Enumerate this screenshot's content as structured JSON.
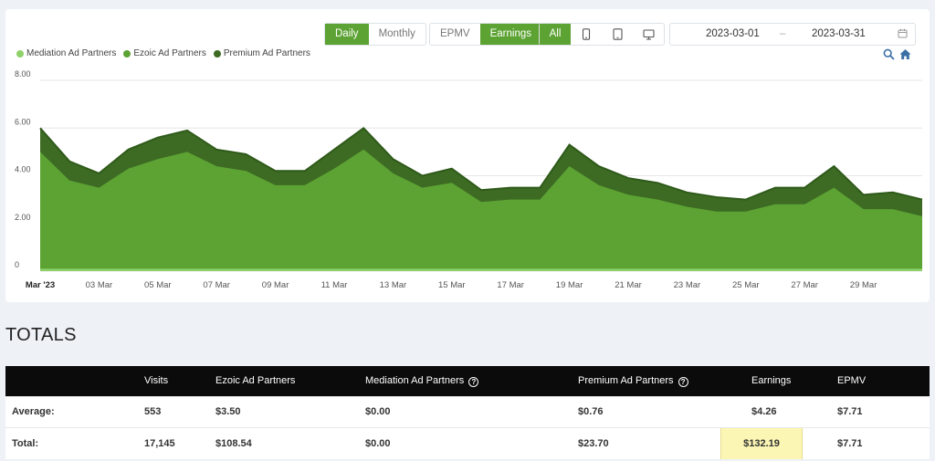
{
  "toolbar": {
    "period": [
      {
        "label": "Daily",
        "active": true
      },
      {
        "label": "Monthly",
        "active": false
      }
    ],
    "metric": [
      {
        "label": "EPMV",
        "active": false
      },
      {
        "label": "Earnings",
        "active": true
      }
    ],
    "device_all_label": "All",
    "device_icons": [
      "phone-icon",
      "tablet-icon",
      "desktop-icon"
    ],
    "date_start": "2023-03-01",
    "date_separator": "–",
    "date_end": "2023-03-31"
  },
  "legend": [
    {
      "name": "Mediation Ad Partners",
      "color": "#8fd16a"
    },
    {
      "name": "Ezoic Ad Partners",
      "color": "#5da334"
    },
    {
      "name": "Premium Ad Partners",
      "color": "#3d6b23"
    }
  ],
  "chart_data": {
    "type": "area",
    "stacked": true,
    "x": [
      "2023-03-01",
      "2023-03-02",
      "2023-03-03",
      "2023-03-04",
      "2023-03-05",
      "2023-03-06",
      "2023-03-07",
      "2023-03-08",
      "2023-03-09",
      "2023-03-10",
      "2023-03-11",
      "2023-03-12",
      "2023-03-13",
      "2023-03-14",
      "2023-03-15",
      "2023-03-16",
      "2023-03-17",
      "2023-03-18",
      "2023-03-19",
      "2023-03-20",
      "2023-03-21",
      "2023-03-22",
      "2023-03-23",
      "2023-03-24",
      "2023-03-25",
      "2023-03-26",
      "2023-03-27",
      "2023-03-28",
      "2023-03-29",
      "2023-03-30",
      "2023-03-31"
    ],
    "x_tick_labels": [
      "Mar '23",
      "03 Mar",
      "05 Mar",
      "07 Mar",
      "09 Mar",
      "11 Mar",
      "13 Mar",
      "15 Mar",
      "17 Mar",
      "19 Mar",
      "21 Mar",
      "23 Mar",
      "25 Mar",
      "27 Mar",
      "29 Mar"
    ],
    "x_tick_indices": [
      0,
      2,
      4,
      6,
      8,
      10,
      12,
      14,
      16,
      18,
      20,
      22,
      24,
      26,
      28
    ],
    "y_tick_labels": [
      "0",
      "2.00",
      "4.00",
      "6.00",
      "8.00"
    ],
    "y_ticks": [
      0,
      2,
      4,
      6,
      8
    ],
    "ylim": [
      0,
      8
    ],
    "series": [
      {
        "name": "Mediation Ad Partners",
        "color": "#8fd16a",
        "values": [
          0.1,
          0.1,
          0.1,
          0.1,
          0.1,
          0.1,
          0.1,
          0.1,
          0.1,
          0.1,
          0.1,
          0.1,
          0.1,
          0.1,
          0.1,
          0.1,
          0.1,
          0.1,
          0.1,
          0.1,
          0.1,
          0.1,
          0.1,
          0.1,
          0.1,
          0.1,
          0.1,
          0.1,
          0.1,
          0.1,
          0.1
        ]
      },
      {
        "name": "Ezoic Ad Partners",
        "color": "#5da334",
        "values": [
          4.9,
          3.7,
          3.4,
          4.2,
          4.6,
          4.9,
          4.3,
          4.1,
          3.5,
          3.5,
          4.2,
          5.0,
          4.0,
          3.4,
          3.6,
          2.8,
          2.9,
          2.9,
          4.3,
          3.5,
          3.1,
          2.9,
          2.6,
          2.4,
          2.4,
          2.7,
          2.7,
          3.4,
          2.5,
          2.5,
          2.2
        ]
      },
      {
        "name": "Premium Ad Partners",
        "color": "#3d6b23",
        "values": [
          1.0,
          0.8,
          0.6,
          0.8,
          0.9,
          0.9,
          0.7,
          0.7,
          0.6,
          0.6,
          0.8,
          0.9,
          0.6,
          0.5,
          0.6,
          0.5,
          0.5,
          0.5,
          0.9,
          0.8,
          0.7,
          0.7,
          0.6,
          0.6,
          0.5,
          0.7,
          0.7,
          0.9,
          0.6,
          0.7,
          0.7
        ]
      }
    ],
    "grid": true,
    "legend_position": "top-left"
  },
  "totals": {
    "title": "TOTALS",
    "columns": [
      "",
      "Visits",
      "Ezoic Ad Partners",
      "Mediation Ad Partners",
      "Premium Ad Partners",
      "Earnings",
      "EPMV"
    ],
    "help_columns": [
      3,
      4
    ],
    "rows": [
      {
        "label": "Average:",
        "visits": "553",
        "ezoic": "$3.50",
        "mediation": "$0.00",
        "premium": "$0.76",
        "earnings": "$4.26",
        "epmv": "$7.71"
      },
      {
        "label": "Total:",
        "visits": "17,145",
        "ezoic": "$108.54",
        "mediation": "$0.00",
        "premium": "$23.70",
        "earnings": "$132.19",
        "epmv": "$7.71"
      }
    ]
  }
}
